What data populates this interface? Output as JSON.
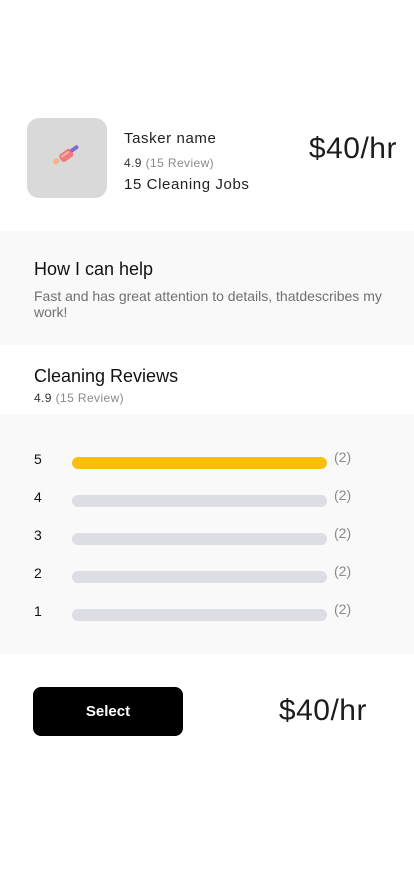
{
  "tasker": {
    "name": "Tasker name",
    "rating": "4.9",
    "review_count": "(15 Review)",
    "jobs": "15 Cleaning Jobs",
    "price": "$40/hr",
    "avatar_icon": "cleaning-brush-icon"
  },
  "help": {
    "title": "How I can help",
    "text": "Fast and has great attention to details, thatdescribes my work!"
  },
  "reviews": {
    "title": "Cleaning Reviews",
    "rating": "4.9",
    "review_count": "(15 Review)",
    "rows": [
      {
        "star": "5",
        "count": "(2)",
        "fill_percent": 100
      },
      {
        "star": "4",
        "count": "(2)",
        "fill_percent": 0
      },
      {
        "star": "3",
        "count": "(2)",
        "fill_percent": 0
      },
      {
        "star": "2",
        "count": "(2)",
        "fill_percent": 0
      },
      {
        "star": "1",
        "count": "(2)",
        "fill_percent": 0
      }
    ]
  },
  "footer": {
    "select_label": "Select",
    "price": "$40/hr"
  },
  "colors": {
    "bar_fill": "#fbbf0a",
    "bar_track": "#dcdee4",
    "button_bg": "#000000"
  }
}
